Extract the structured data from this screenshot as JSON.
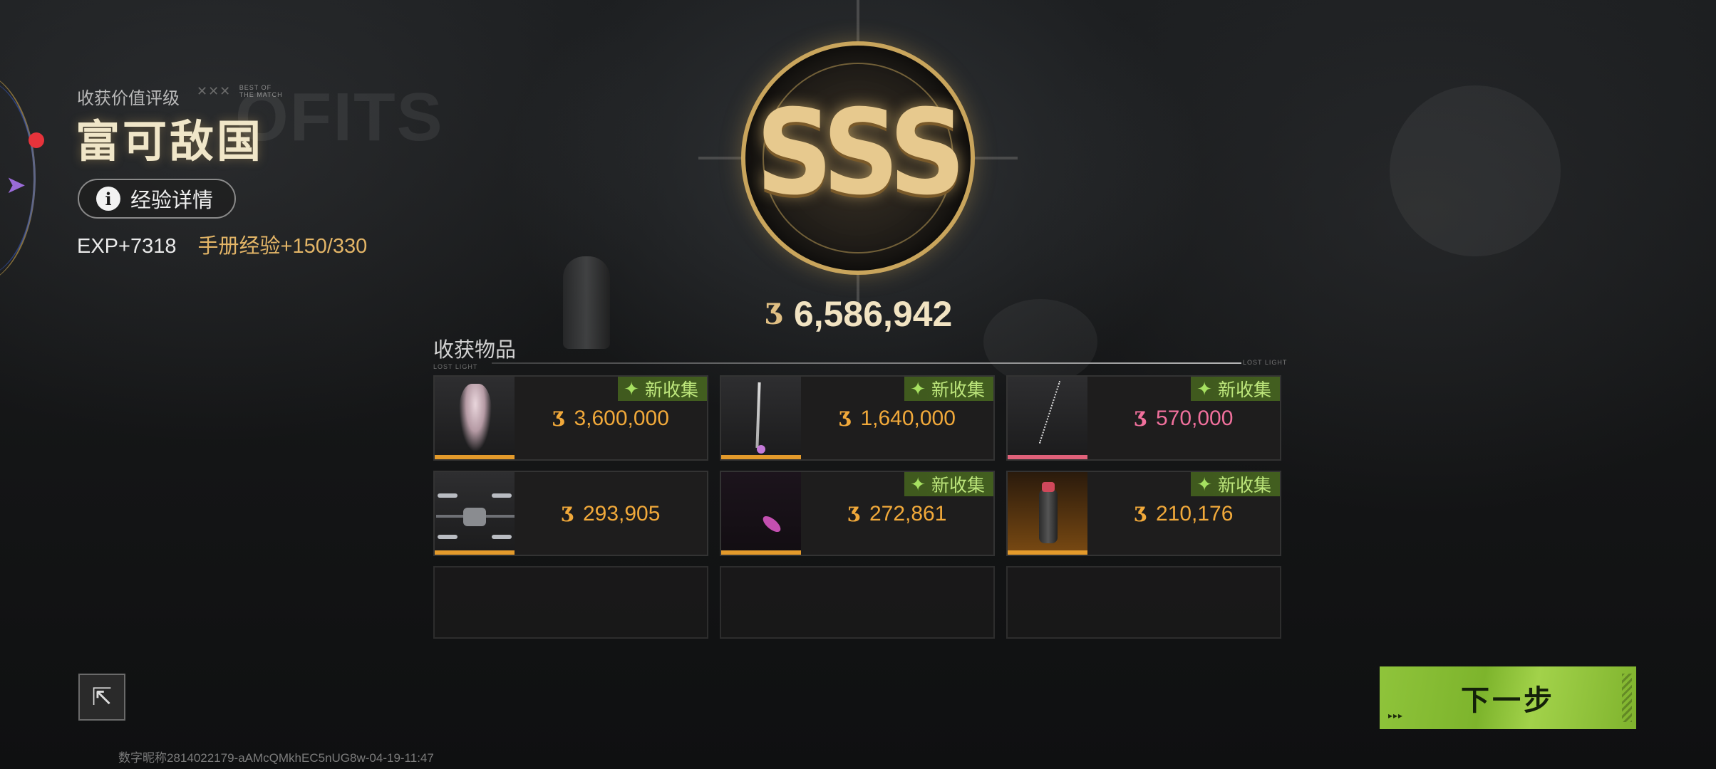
{
  "rating": {
    "label": "收获价值评级",
    "tag_line1": "BEST OF",
    "tag_line2": "THE MATCH",
    "title": "富可敌国",
    "ghost_text": "OFITS"
  },
  "exp": {
    "details_button": "经验详情",
    "exp_text": "EXP+7318",
    "manual_exp": "手册经验+150/330"
  },
  "grade": "SSS",
  "total": {
    "coin_icon": "coin-icon",
    "value": "6,586,942"
  },
  "loot": {
    "title": "收获物品",
    "subtitle": "LOST LIGHT",
    "end_tag": "LOST LIGHT",
    "badge_text": "新收集",
    "items": [
      {
        "name": "phoenix-statue",
        "value": "3,600,000",
        "new": true,
        "rarity_color": "#e39a2b",
        "value_color": "#f1a93a"
      },
      {
        "name": "golf-club",
        "value": "1,640,000",
        "new": true,
        "rarity_color": "#e39a2b",
        "value_color": "#f1a93a"
      },
      {
        "name": "necklace-chain",
        "value": "570,000",
        "new": true,
        "rarity_color": "#e0617a",
        "value_color": "#f0709c"
      },
      {
        "name": "drone",
        "value": "293,905",
        "new": false,
        "rarity_color": "#e39a2b",
        "value_color": "#f1a93a"
      },
      {
        "name": "spray-item",
        "value": "272,861",
        "new": true,
        "rarity_color": "#e39a2b",
        "value_color": "#f1a93a"
      },
      {
        "name": "canister",
        "value": "210,176",
        "new": true,
        "rarity_color": "#e39a2b",
        "value_color": "#f1a93a"
      }
    ]
  },
  "footer": {
    "id_text": "数字昵称2814022179-aAMcQMkhEC5nUG8w-04-19-11:47",
    "next_button": "下一步",
    "next_arrows": "▸▸▸"
  },
  "colors": {
    "accent_green": "#8fc43b",
    "gold": "#e7c98e",
    "badge_green": "#bde67b"
  }
}
